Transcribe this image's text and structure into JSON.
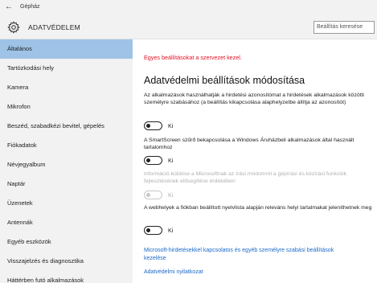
{
  "window": {
    "back_glyph": "←",
    "title": "Gépház"
  },
  "header": {
    "icon": "gear-icon",
    "title": "ADATVÉDELEM",
    "search_placeholder": "Beállítás keresése"
  },
  "sidebar": {
    "items": [
      {
        "label": "Általános",
        "selected": true
      },
      {
        "label": "Tartózkodási hely"
      },
      {
        "label": "Kamera"
      },
      {
        "label": "Mikrofon"
      },
      {
        "label": "Beszéd, szabadkézi bevitel, gépelés"
      },
      {
        "label": "Fiókadatok"
      },
      {
        "label": "Névjegyalbum"
      },
      {
        "label": "Naptár"
      },
      {
        "label": "Üzenetek"
      },
      {
        "label": "Antennák"
      },
      {
        "label": "Egyéb eszközök"
      },
      {
        "label": "Visszajelzés és diagnosztika"
      },
      {
        "label": "Háttérben futó alkalmazások"
      }
    ]
  },
  "main": {
    "managed_notice": "Egyes beállításokat a szervezet kezel.",
    "heading": "Adatvédelmi beállítások módosítása",
    "settings": [
      {
        "description": "Az alkalmazások használhatják a hirdetési azonosítómat a hirdetések alkalmazások közötti személyre szabásához (a beállítás kikapcsolása alaphelyzetbe állítja az azonosítót)",
        "state": "Ki",
        "enabled": true
      },
      {
        "description": "A SmartScreen szűrő bekapcsolása a Windows Áruházbeli alkalmazások által használt tartalomhoz",
        "state": "Ki",
        "enabled": true
      },
      {
        "description": "Információ küldése a Microsoftnak az írási módomról a gépírási és kézírási funkciók fejlesztésének elősegítése érdekében",
        "state": "Ki",
        "enabled": false
      },
      {
        "description": "A webhelyek a fiókban beállított nyelvlista alapján releváns helyi tartalmakat jeleníthetnek meg",
        "state": "Ki",
        "enabled": true
      }
    ],
    "links": {
      "ads_info": "Microsoft-hirdetésekkel kapcsolatos és egyéb személyre szabási beállítások kezelése",
      "privacy_statement": "Adatvédelmi nyilatkozat"
    }
  },
  "colors": {
    "accent_selected": "#9ec3e6",
    "link": "#1b6ac9",
    "warning": "#e81123",
    "chrome": "#f2f2f2"
  }
}
